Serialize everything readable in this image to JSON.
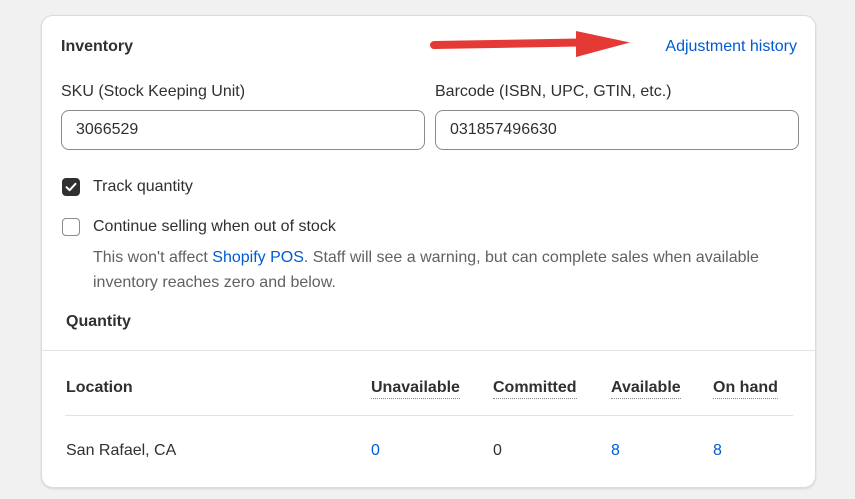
{
  "inventory": {
    "title": "Inventory",
    "history_link": "Adjustment history",
    "sku": {
      "label": "SKU (Stock Keeping Unit)",
      "value": "3066529"
    },
    "barcode": {
      "label": "Barcode (ISBN, UPC, GTIN, etc.)",
      "value": "031857496630"
    },
    "track_quantity": {
      "label": "Track quantity",
      "checked": true
    },
    "continue_selling": {
      "label": "Continue selling when out of stock",
      "checked": false,
      "help_prefix": "This won't affect ",
      "help_link": "Shopify POS",
      "help_suffix": ". Staff will see a warning, but can complete sales when available inventory reaches zero and below."
    }
  },
  "quantity": {
    "title": "Quantity",
    "columns": [
      "Location",
      "Unavailable",
      "Committed",
      "Available",
      "On hand"
    ],
    "rows": [
      {
        "location": "San Rafael, CA",
        "unavailable": "0",
        "committed": "0",
        "available": "8",
        "on_hand": "8"
      }
    ]
  },
  "colors": {
    "link": "#005bd3",
    "annotation_arrow": "#e53935",
    "text": "#303030",
    "muted_text": "#616161"
  },
  "icons": {
    "checkbox_checked": "checkmark-icon",
    "annotation": "arrow-right-icon"
  }
}
